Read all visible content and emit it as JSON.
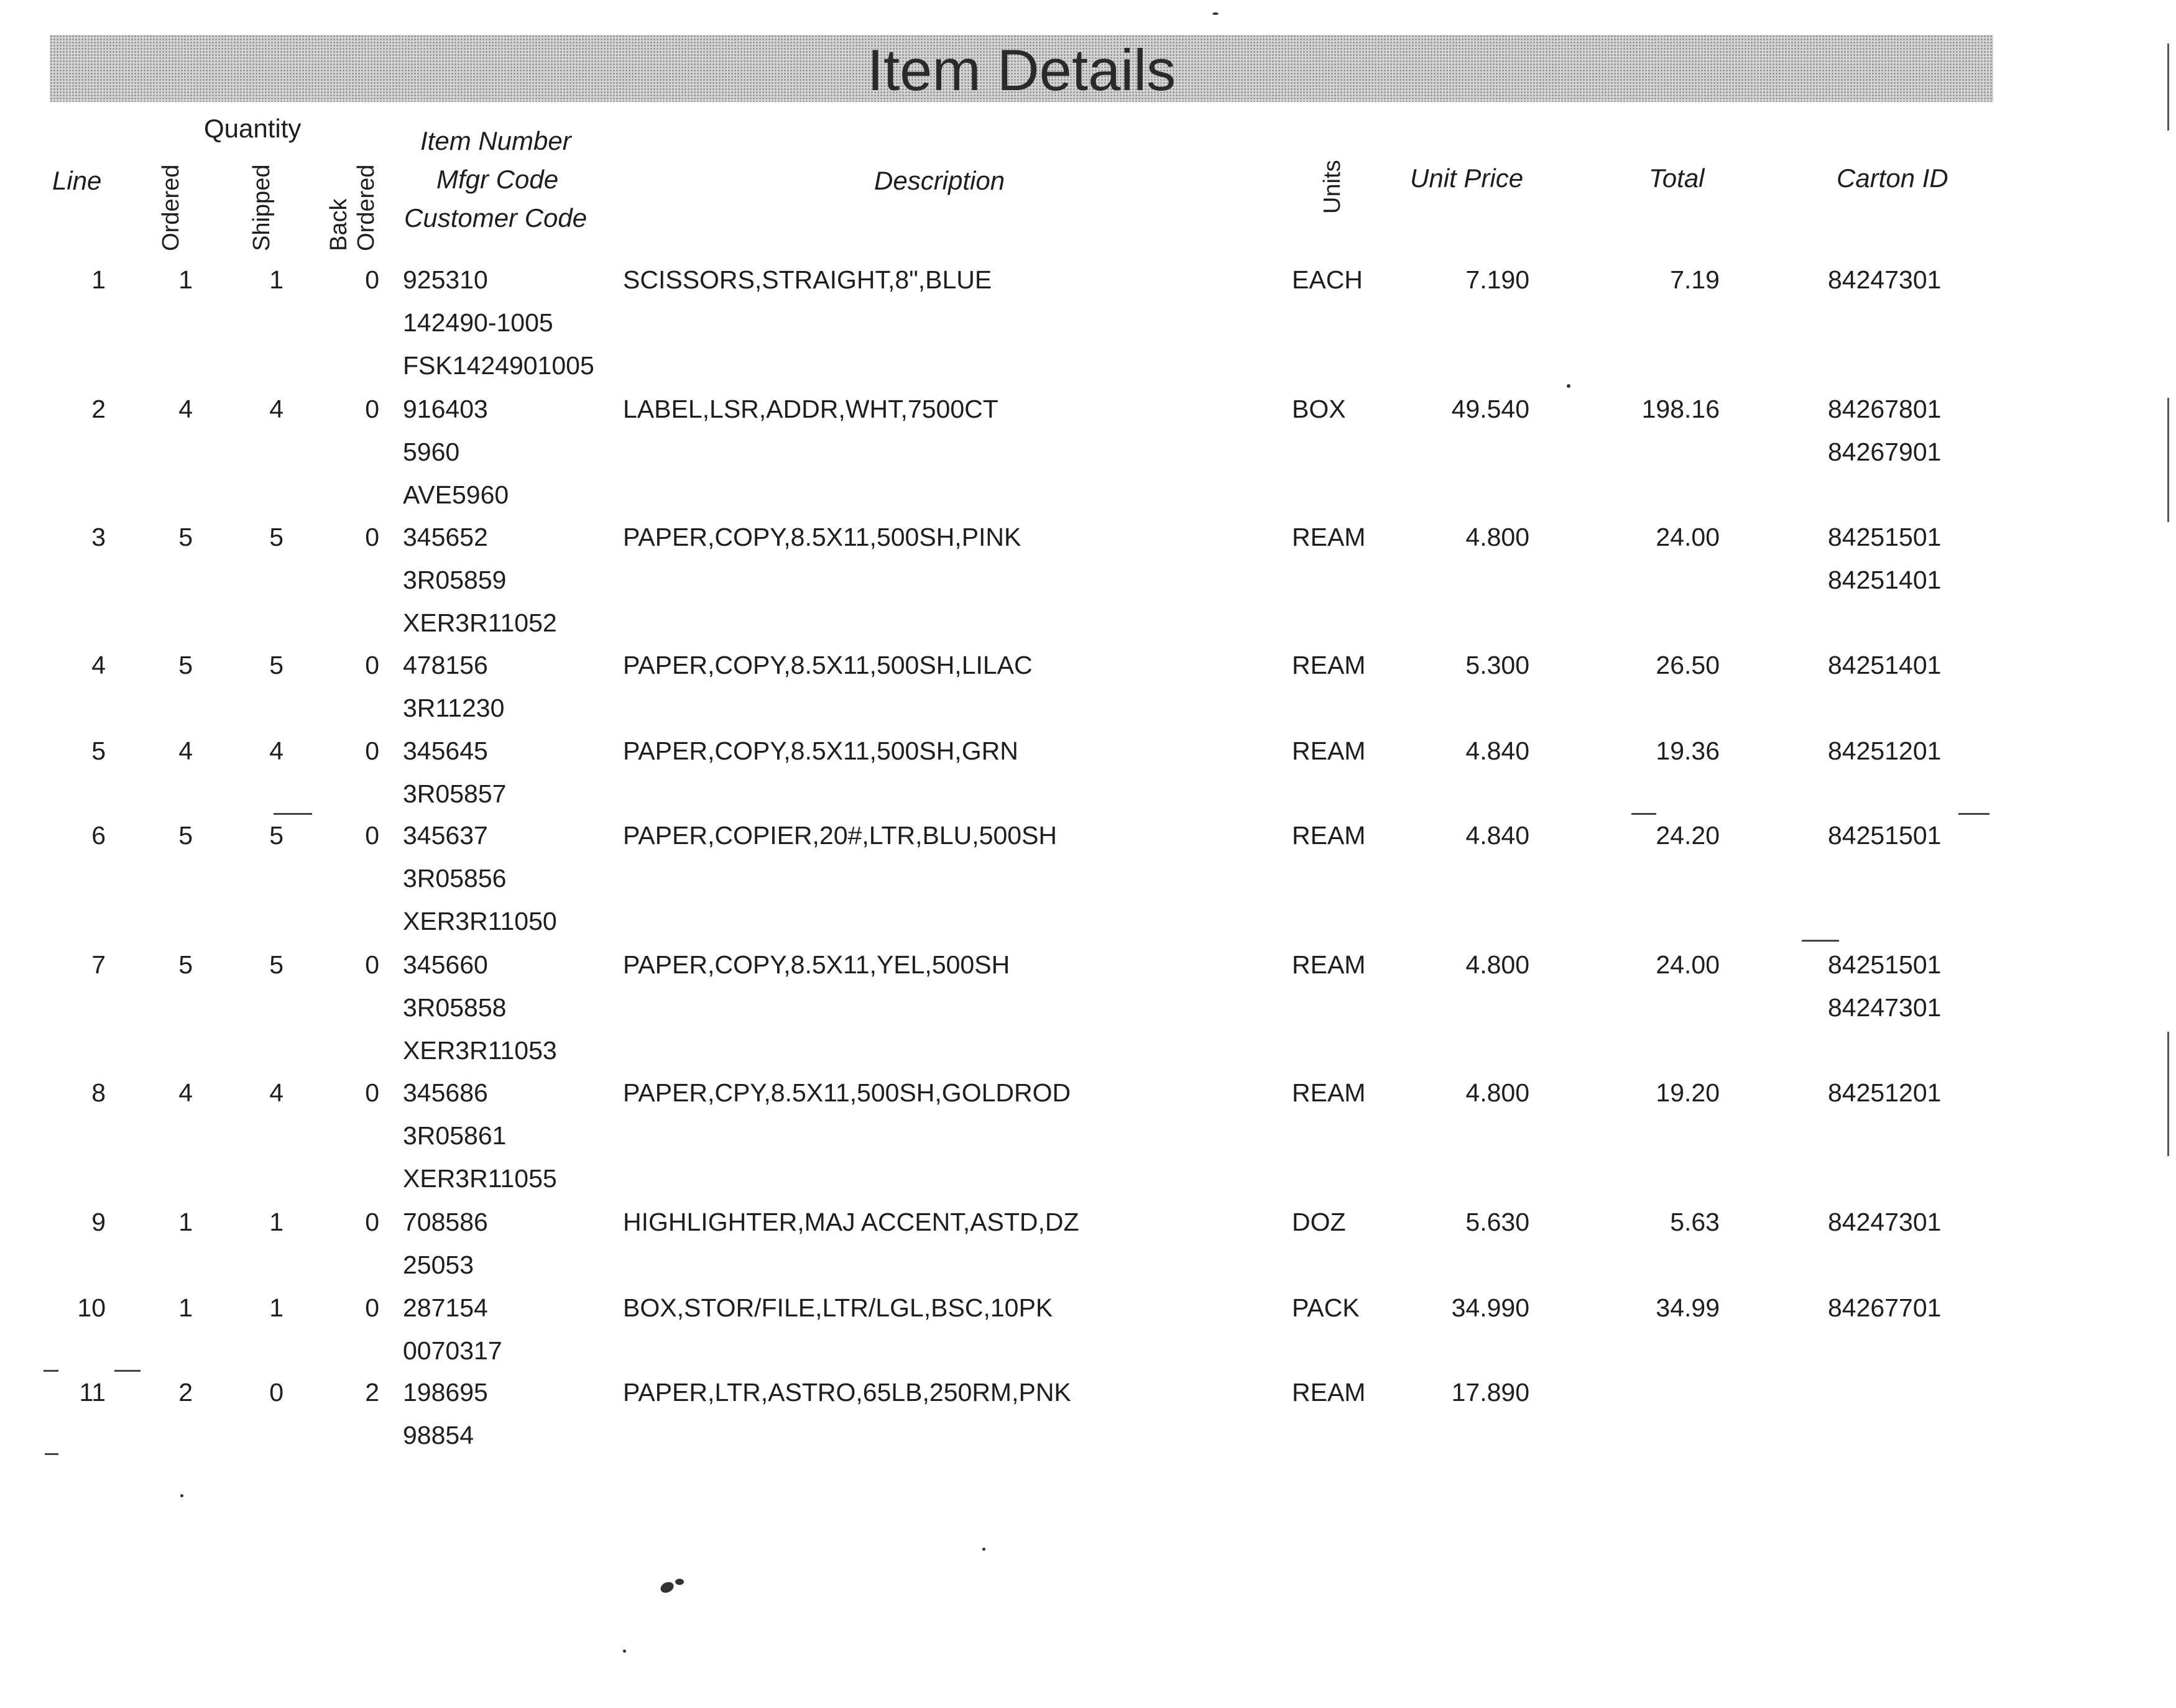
{
  "page": {
    "title": "Item Details"
  },
  "headers": {
    "quantity": "Quantity",
    "line": "Line",
    "ordered": "Ordered",
    "shipped": "Shipped",
    "back": "Back",
    "back_ordered": "Ordered",
    "item_number": "Item Number",
    "mfgr_code": "Mfgr Code",
    "customer_code": "Customer Code",
    "description": "Description",
    "units": "Units",
    "unit_price": "Unit Price",
    "total": "Total",
    "carton_id": "Carton ID"
  },
  "rows": [
    {
      "line": "1",
      "ordered": "1",
      "shipped": "1",
      "back_ordered": "0",
      "item_number": "925310",
      "mfgr_code": "142490-1005",
      "customer_code": "FSK1424901005",
      "description": "SCISSORS,STRAIGHT,8\",BLUE",
      "units": "EACH",
      "unit_price": "7.190",
      "total": "7.19",
      "carton_ids": [
        "84247301"
      ]
    },
    {
      "line": "2",
      "ordered": "4",
      "shipped": "4",
      "back_ordered": "0",
      "item_number": "916403",
      "mfgr_code": "5960",
      "customer_code": "AVE5960",
      "description": "LABEL,LSR,ADDR,WHT,7500CT",
      "units": "BOX",
      "unit_price": "49.540",
      "total": "198.16",
      "carton_ids": [
        "84267801",
        "84267901"
      ]
    },
    {
      "line": "3",
      "ordered": "5",
      "shipped": "5",
      "back_ordered": "0",
      "item_number": "345652",
      "mfgr_code": "3R05859",
      "customer_code": "XER3R11052",
      "description": "PAPER,COPY,8.5X11,500SH,PINK",
      "units": "REAM",
      "unit_price": "4.800",
      "total": "24.00",
      "carton_ids": [
        "84251501",
        "84251401"
      ]
    },
    {
      "line": "4",
      "ordered": "5",
      "shipped": "5",
      "back_ordered": "0",
      "item_number": "478156",
      "mfgr_code": "3R11230",
      "customer_code": "",
      "description": "PAPER,COPY,8.5X11,500SH,LILAC",
      "units": "REAM",
      "unit_price": "5.300",
      "total": "26.50",
      "carton_ids": [
        "84251401"
      ]
    },
    {
      "line": "5",
      "ordered": "4",
      "shipped": "4",
      "back_ordered": "0",
      "item_number": "345645",
      "mfgr_code": "3R05857",
      "customer_code": "",
      "description": "PAPER,COPY,8.5X11,500SH,GRN",
      "units": "REAM",
      "unit_price": "4.840",
      "total": "19.36",
      "carton_ids": [
        "84251201"
      ]
    },
    {
      "line": "6",
      "ordered": "5",
      "shipped": "5",
      "back_ordered": "0",
      "item_number": "345637",
      "mfgr_code": "3R05856",
      "customer_code": "XER3R11050",
      "description": "PAPER,COPIER,20#,LTR,BLU,500SH",
      "units": "REAM",
      "unit_price": "4.840",
      "total": "24.20",
      "carton_ids": [
        "84251501"
      ]
    },
    {
      "line": "7",
      "ordered": "5",
      "shipped": "5",
      "back_ordered": "0",
      "item_number": "345660",
      "mfgr_code": "3R05858",
      "customer_code": "XER3R11053",
      "description": "PAPER,COPY,8.5X11,YEL,500SH",
      "units": "REAM",
      "unit_price": "4.800",
      "total": "24.00",
      "carton_ids": [
        "84251501",
        "84247301"
      ]
    },
    {
      "line": "8",
      "ordered": "4",
      "shipped": "4",
      "back_ordered": "0",
      "item_number": "345686",
      "mfgr_code": "3R05861",
      "customer_code": "XER3R11055",
      "description": "PAPER,CPY,8.5X11,500SH,GOLDROD",
      "units": "REAM",
      "unit_price": "4.800",
      "total": "19.20",
      "carton_ids": [
        "84251201"
      ]
    },
    {
      "line": "9",
      "ordered": "1",
      "shipped": "1",
      "back_ordered": "0",
      "item_number": "708586",
      "mfgr_code": "25053",
      "customer_code": "",
      "description": "HIGHLIGHTER,MAJ ACCENT,ASTD,DZ",
      "units": "DOZ",
      "unit_price": "5.630",
      "total": "5.63",
      "carton_ids": [
        "84247301"
      ]
    },
    {
      "line": "10",
      "ordered": "1",
      "shipped": "1",
      "back_ordered": "0",
      "item_number": "287154",
      "mfgr_code": "0070317",
      "customer_code": "",
      "description": "BOX,STOR/FILE,LTR/LGL,BSC,10PK",
      "units": "PACK",
      "unit_price": "34.990",
      "total": "34.99",
      "carton_ids": [
        "84267701"
      ]
    },
    {
      "line": "11",
      "ordered": "2",
      "shipped": "0",
      "back_ordered": "2",
      "item_number": "198695",
      "mfgr_code": "98854",
      "customer_code": "",
      "description": "PAPER,LTR,ASTRO,65LB,250RM,PNK",
      "units": "REAM",
      "unit_price": "17.890",
      "total": "",
      "carton_ids": []
    }
  ]
}
